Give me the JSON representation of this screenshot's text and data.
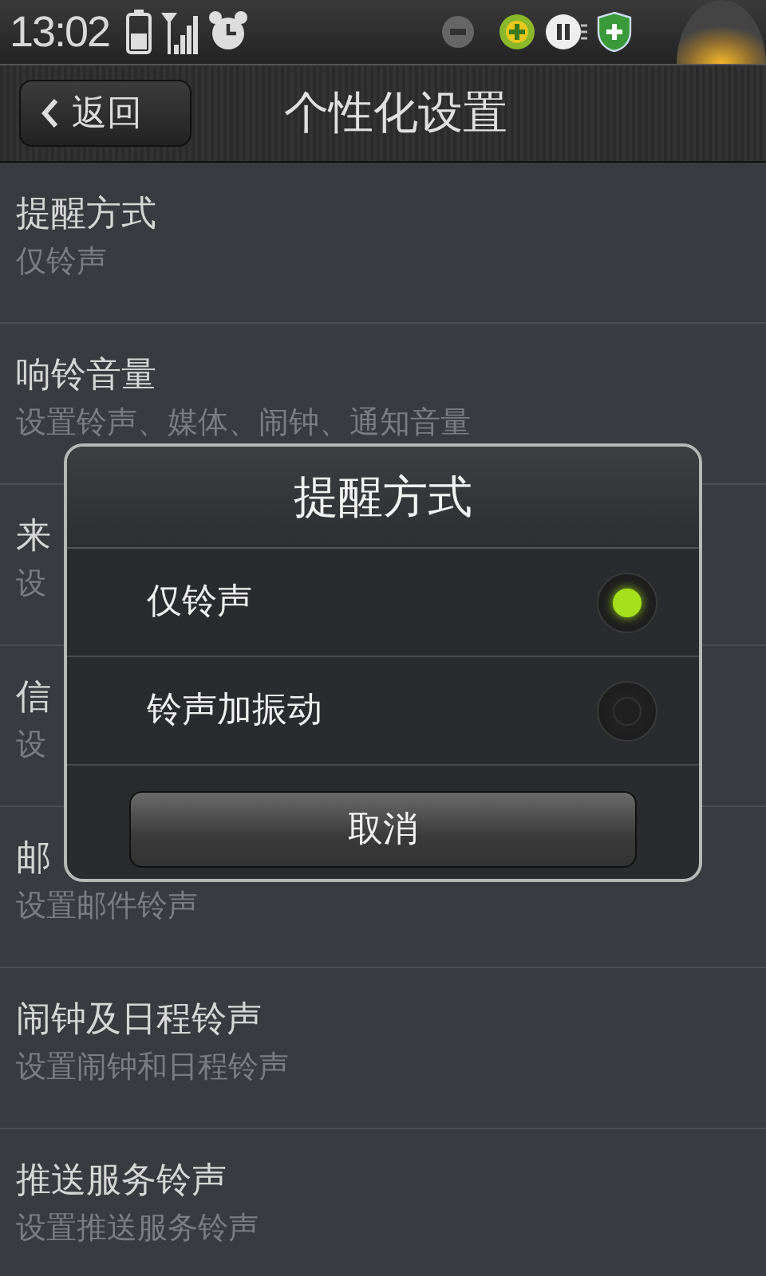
{
  "status_bar": {
    "time": "13:02"
  },
  "header": {
    "back_label": "返回",
    "title": "个性化设置"
  },
  "settings": [
    {
      "title": "提醒方式",
      "subtitle": "仅铃声"
    },
    {
      "title": "响铃音量",
      "subtitle": "设置铃声、媒体、闹钟、通知音量"
    },
    {
      "title": "来",
      "subtitle": "设"
    },
    {
      "title": "信",
      "subtitle": "设"
    },
    {
      "title": "邮",
      "subtitle": "设置邮件铃声"
    },
    {
      "title": "闹钟及日程铃声",
      "subtitle": "设置闹钟和日程铃声"
    },
    {
      "title": "推送服务铃声",
      "subtitle": "设置推送服务铃声"
    }
  ],
  "dialog": {
    "title": "提醒方式",
    "options": [
      {
        "label": "仅铃声",
        "selected": true
      },
      {
        "label": "铃声加振动",
        "selected": false
      }
    ],
    "cancel": "取消"
  }
}
